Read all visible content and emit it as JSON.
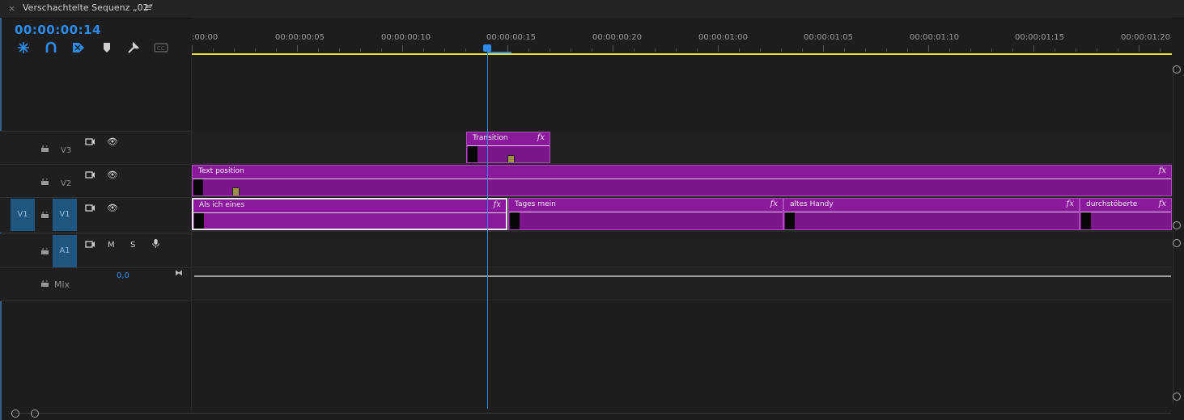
{
  "tab": {
    "close": "×",
    "title": "Verschachtelte Sequenz „02“",
    "menu_icon": "≡"
  },
  "timecode": "00:00:00:14",
  "toolbar": {
    "tools": [
      "snap-icon",
      "linked-selection-icon",
      "insert-overwrite-icon",
      "marker-icon",
      "wrench-icon",
      "captions-icon"
    ]
  },
  "ruler": {
    "labels": [
      ":00:00",
      "00:00:00:05",
      "00:00:00:10",
      "00:00:00:15",
      "00:00:00:20",
      "00:00:01:00",
      "00:00:01:05",
      "00:00:01:10",
      "00:00:01:15",
      "00:00:01:20"
    ]
  },
  "tracks": {
    "v3": {
      "name": "V3"
    },
    "v2": {
      "name": "V2"
    },
    "v1": {
      "name": "V1",
      "source_patch": "V1"
    },
    "a1": {
      "name": "A1",
      "mute": "M",
      "solo": "S"
    },
    "mix": {
      "name": "Mix",
      "value": "0,0"
    }
  },
  "clips": {
    "transition": {
      "name": "Transition",
      "fx": "fx"
    },
    "text_position": {
      "name": "Text position",
      "fx": "fx"
    },
    "v1_clips": [
      {
        "name": "Als ich eines",
        "fx": "fx"
      },
      {
        "name": "Tages mein",
        "fx": "fx"
      },
      {
        "name": "altes Handy",
        "fx": "fx"
      },
      {
        "name": "durchstöberte",
        "fx": "fx"
      }
    ]
  },
  "colors": {
    "accent": "#2d8ceb",
    "clip": "#8a1a9b",
    "work_area": "#e7e030"
  }
}
